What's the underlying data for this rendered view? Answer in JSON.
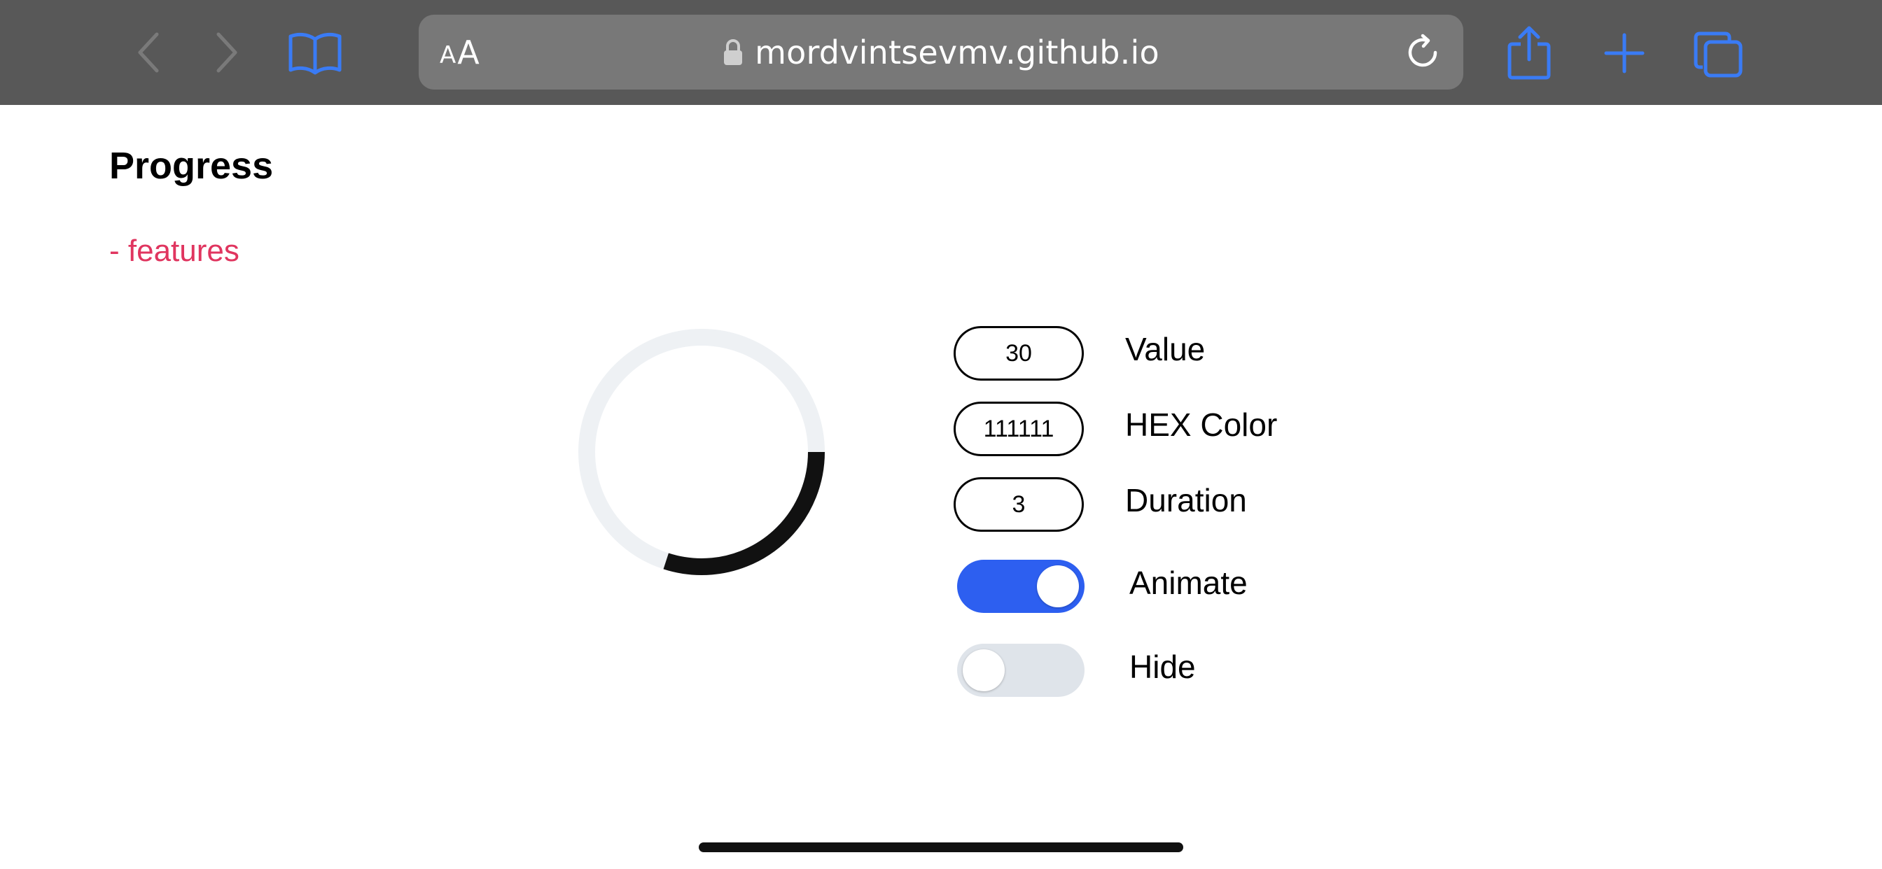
{
  "browser": {
    "url": "mordvintsevmv.github.io",
    "text_size_small": "A",
    "text_size_big": "A",
    "icons": {
      "back": "chevron-left-icon",
      "forward": "chevron-right-icon",
      "bookmarks": "book-icon",
      "lock": "lock-icon",
      "reload": "reload-icon",
      "share": "share-icon",
      "new_tab": "plus-icon",
      "tabs": "tabs-icon"
    },
    "colors": {
      "toolbar": "#585858",
      "address_bar": "#787878",
      "accent": "#3a7bf5",
      "disabled": "#7a7a7a"
    }
  },
  "page": {
    "title": "Progress",
    "features_link": "- features",
    "link_color": "#e0355f"
  },
  "progress": {
    "value_percent": 30,
    "color": "#111111",
    "track_color": "#eef1f4"
  },
  "controls": {
    "value": {
      "label": "Value",
      "input": "30"
    },
    "hex_color": {
      "label": "HEX Color",
      "input": "111111"
    },
    "duration": {
      "label": "Duration",
      "input": "3"
    },
    "animate": {
      "label": "Animate",
      "on": true
    },
    "hide": {
      "label": "Hide",
      "on": false
    },
    "toggle_on_color": "#2d5ff0",
    "toggle_off_color": "#dfe4ea"
  }
}
